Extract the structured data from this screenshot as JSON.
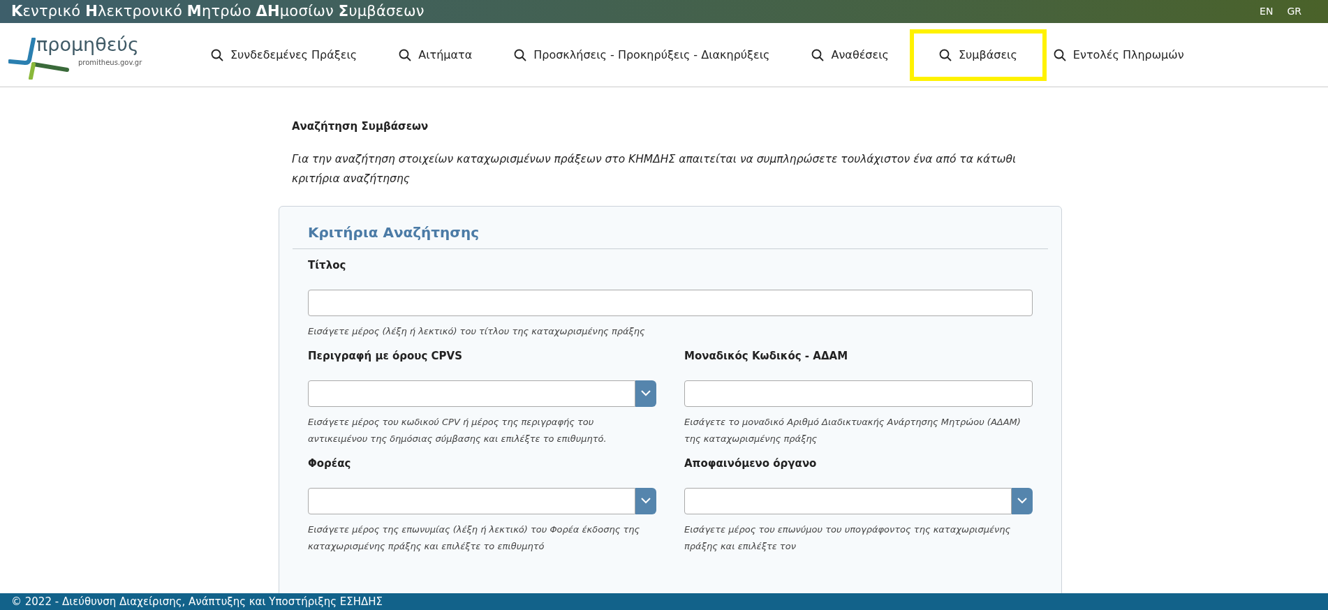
{
  "top_bar": {
    "title": "**Κ**εντρικό **Η**λεκτρονικό **Μ**ητρώο **ΔΗ**μοσίων **Σ**υμβάσεων",
    "languages": [
      "EN",
      "GR"
    ]
  },
  "logo": {
    "name": "προμηθεύς",
    "domain": "promitheus.gov.gr"
  },
  "nav": [
    {
      "label": "Συνδεδεμένες Πράξεις",
      "selected": false
    },
    {
      "label": "Αιτήματα",
      "selected": false
    },
    {
      "label": "Προσκλήσεις - Προκηρύξεις - Διακηρύξεις",
      "selected": false
    },
    {
      "label": "Αναθέσεις",
      "selected": false
    },
    {
      "label": "Συμβάσεις",
      "selected": true
    },
    {
      "label": "Εντολές Πληρωμών",
      "selected": false
    }
  ],
  "page": {
    "heading": "Αναζήτηση Συμβάσεων",
    "intro": "Για την αναζήτηση στοιχείων καταχωρισμένων πράξεων στο ΚΗΜΔΗΣ απαιτείται να συμπληρώσετε τουλάχιστον ένα από τα κάτωθι κριτήρια αναζήτησης"
  },
  "criteria": {
    "title": "Κριτήρια Αναζήτησης",
    "rows": [
      [
        {
          "kind": "text",
          "label": "Τίτλος",
          "hint": "Εισάγετε μέρος (λέξη ή λεκτικό) του τίτλου της καταχωρισμένης πράξης"
        }
      ],
      [
        {
          "kind": "combo",
          "label": "Περιγραφή με όρους CPVS",
          "hint": "Εισάγετε μέρος του κωδικού CPV ή μέρος της περιγραφής του αντικειμένου της δημόσιας σύμβασης και επιλέξτε το επιθυμητό."
        },
        {
          "kind": "text",
          "label": "Μοναδικός Κωδικός - ΑΔΑΜ",
          "hint": "Εισάγετε το μοναδικό Αριθμό Διαδικτυακής Ανάρτησης Μητρώου (ΑΔΑΜ) της καταχωρισμένης πράξης"
        }
      ],
      [
        {
          "kind": "combo",
          "label": "Φορέας",
          "hint": "Εισάγετε μέρος της επωνυμίας (λέξη ή λεκτικό) του Φορέα έκδοσης της καταχωρισμένης πράξης και επιλέξτε το επιθυμητό"
        },
        {
          "kind": "combo",
          "label": "Αποφαινόμενο όργανο",
          "hint": "Εισάγετε μέρος του επωνύμου του υπογράφοντος της καταχωρισμένης πράξης και επιλέξτε τον"
        }
      ]
    ]
  },
  "footer": "© 2022 - Διεύθυνση Διαχείρισης, Ανάπτυξης και Υποστήριξης ΕΣΗΔΗΣ"
}
